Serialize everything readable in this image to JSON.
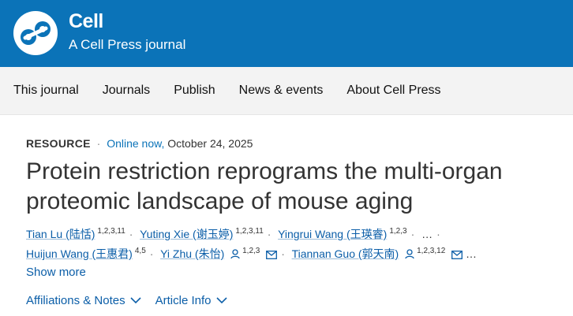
{
  "brand": {
    "name": "Cell",
    "tagline": "A Cell Press journal"
  },
  "nav": {
    "items": [
      "This journal",
      "Journals",
      "Publish",
      "News & events",
      "About Cell Press"
    ]
  },
  "article": {
    "type": "RESOURCE",
    "status": "Online now,",
    "date": "October 24, 2025",
    "title": "Protein restriction reprograms the multi-organ proteomic landscape of mouse aging",
    "authors": [
      {
        "name": "Tian Lu (陆恬)",
        "affil": "1,2,3,11"
      },
      {
        "name": "Yuting Xie (谢玉婷)",
        "affil": "1,2,3,11"
      },
      {
        "name": "Yingrui Wang (王瑛睿)",
        "affil": "1,2,3"
      },
      {
        "name": "Huijun Wang (王惠君)",
        "affil": "4,5"
      },
      {
        "name": "Yi Zhu (朱怡)",
        "affil": "1,2,3"
      },
      {
        "name": "Tiannan Guo (郭天南)",
        "affil": "1,2,3,12"
      }
    ],
    "ellipsis": "…",
    "show_more": "Show more"
  },
  "links": {
    "affiliations": "Affiliations & Notes",
    "article_info": "Article Info"
  },
  "colors": {
    "header_bg": "#0b73b8",
    "link": "#0b5ea8"
  },
  "icons": [
    "cell-logo-icon",
    "person-icon",
    "mail-icon",
    "chevron-down-icon"
  ]
}
